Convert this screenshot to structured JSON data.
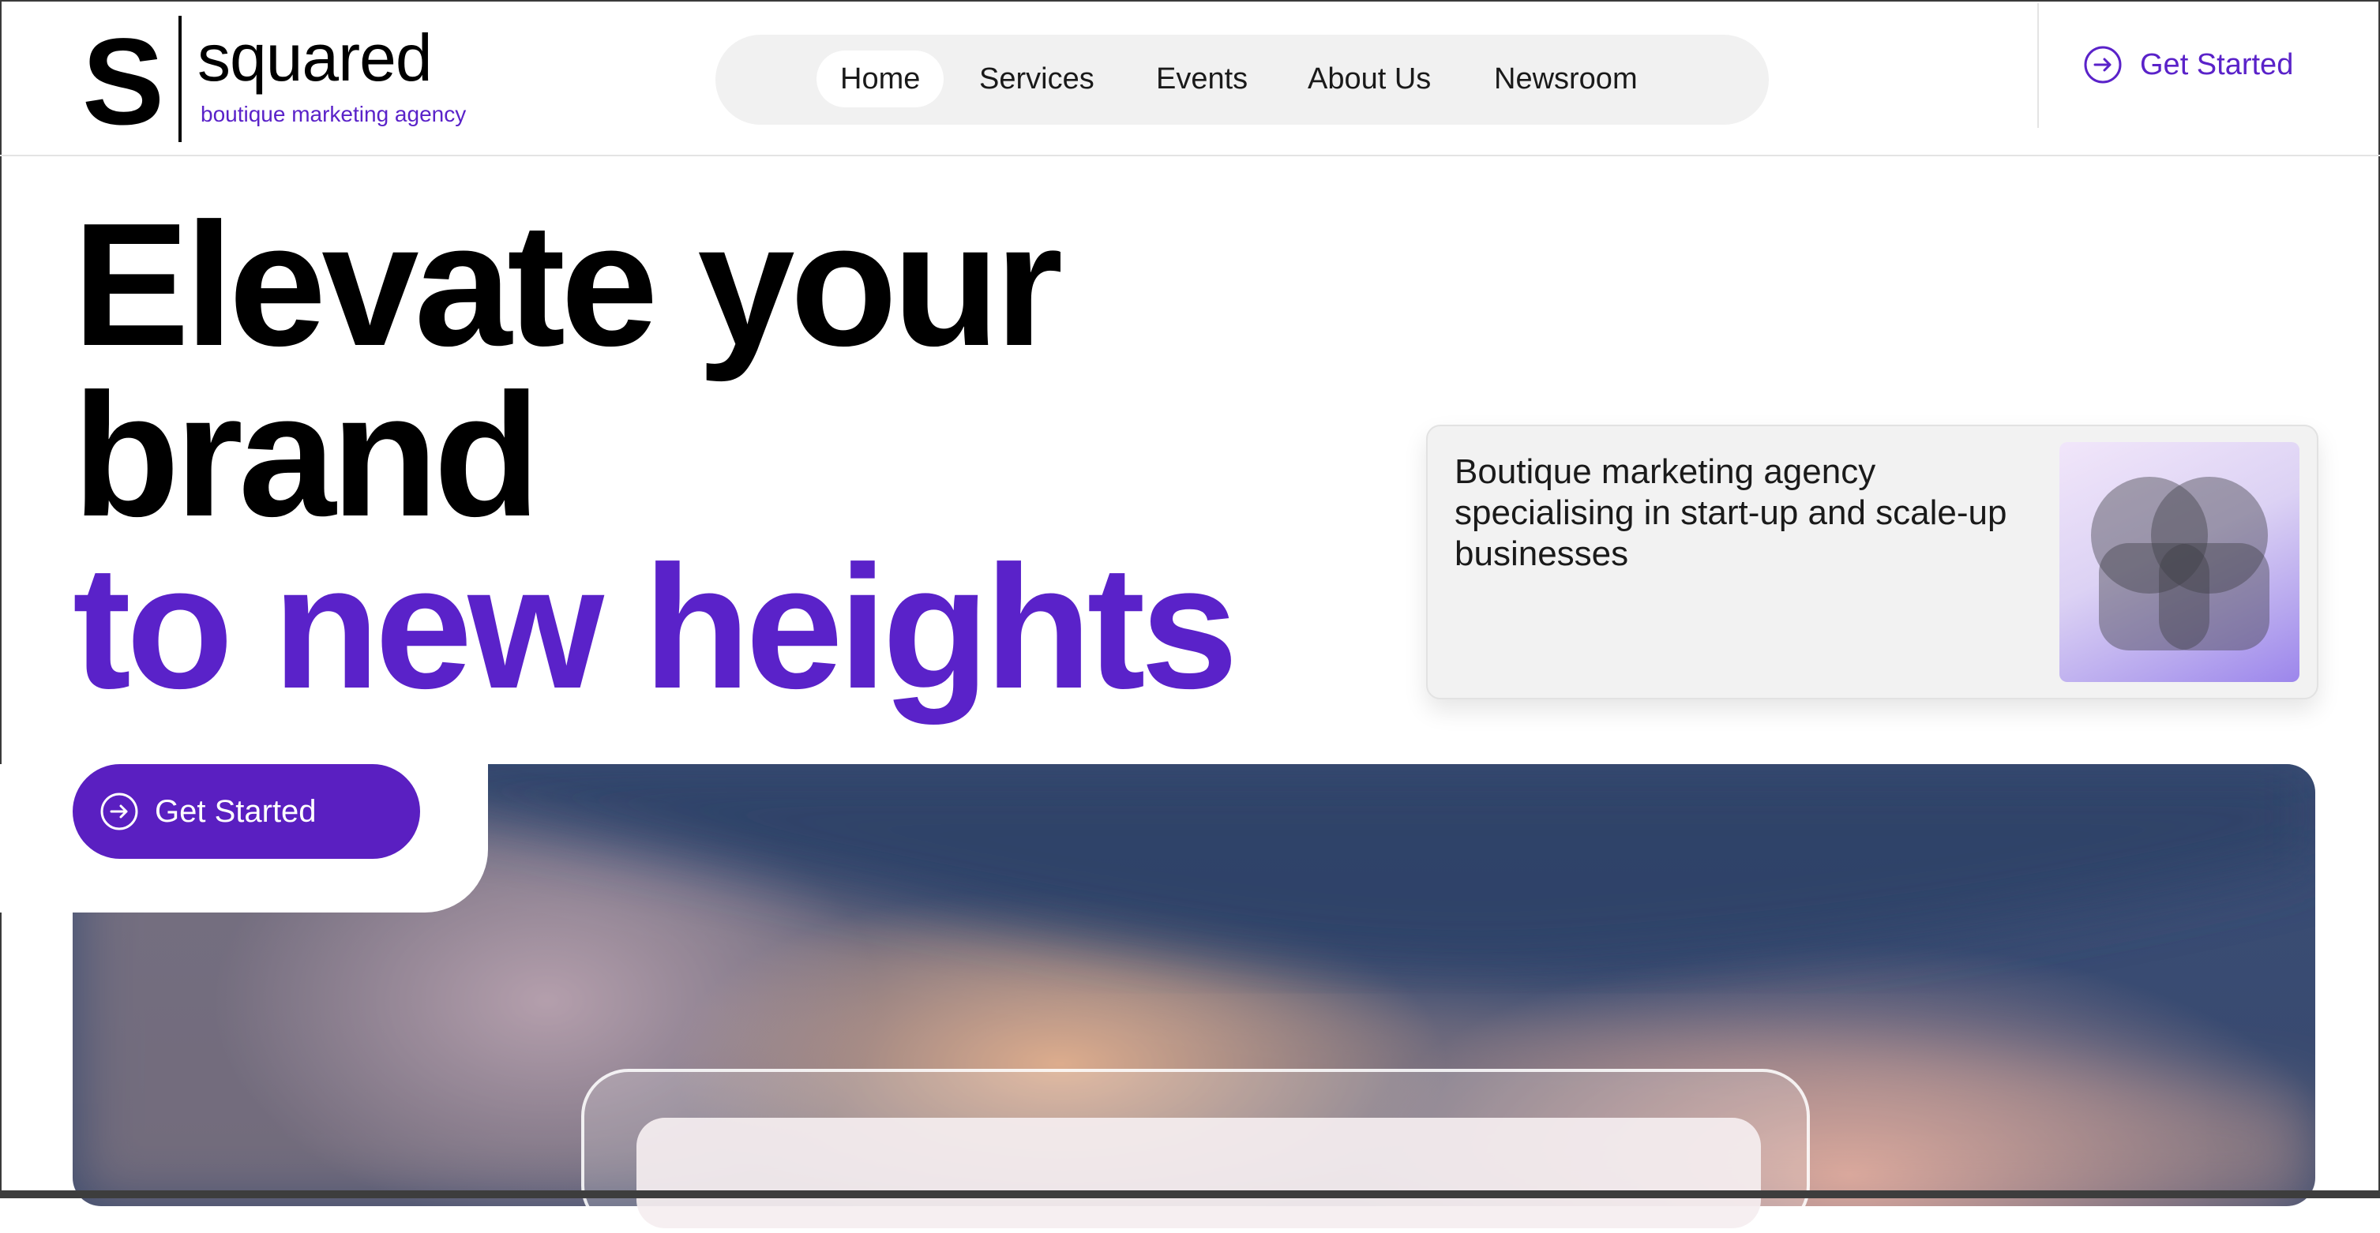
{
  "brand": {
    "mark": "S",
    "name": "squared",
    "tagline": "boutique marketing agency",
    "accent_color": "#5a22c9"
  },
  "nav": {
    "items": [
      {
        "label": "Home",
        "active": true
      },
      {
        "label": "Services",
        "active": false
      },
      {
        "label": "Events",
        "active": false
      },
      {
        "label": "About Us",
        "active": false
      },
      {
        "label": "Newsroom",
        "active": false
      }
    ]
  },
  "header": {
    "cta_label": "Get Started",
    "cta_icon": "arrow-right-circle-icon"
  },
  "hero": {
    "line1": "Elevate your",
    "line2": "brand",
    "line3": "to new heights",
    "cta_label": "Get Started",
    "cta_icon": "arrow-right-circle-icon",
    "cta_color": "#5a1fc1"
  },
  "info_card": {
    "text": "Boutique marketing agency specialising in start-up and scale-up businesses",
    "image_icon": "overlapping-circles-graphic"
  }
}
